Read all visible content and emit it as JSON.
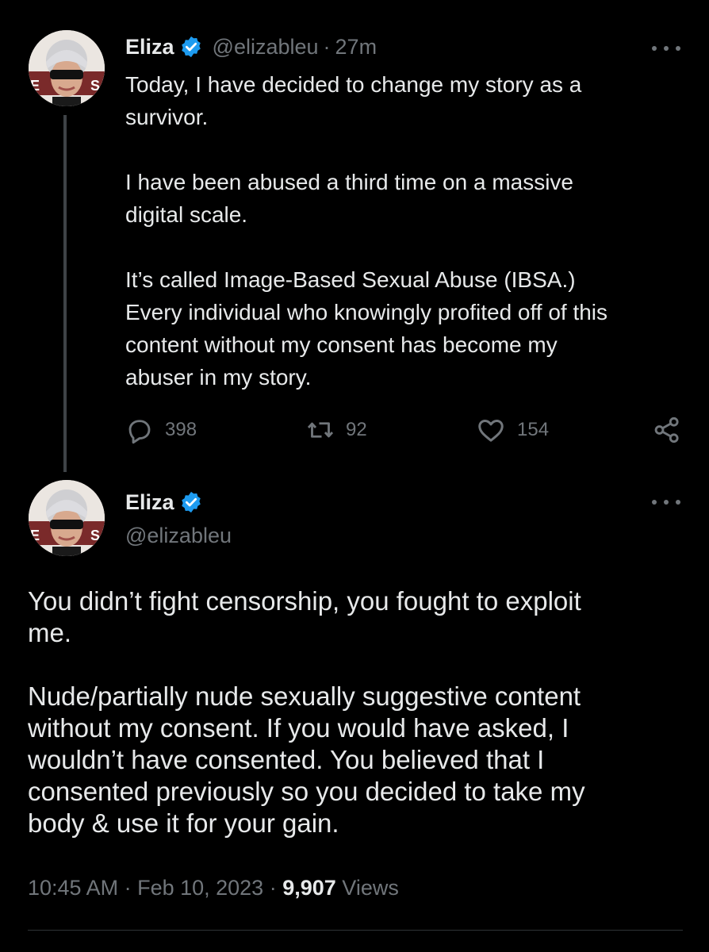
{
  "colors": {
    "background": "#000000",
    "text": "#e7e9ea",
    "secondary_text": "#71767b",
    "verified_blue": "#1d9bf0",
    "divider": "#2f3336"
  },
  "tweet1": {
    "author_name": "Eliza",
    "author_handle": "@elizableu",
    "separator": "·",
    "time": "27m",
    "avatar_icon": "profile-photo",
    "text": "Today, I have decided to change my story as a\nsurvivor.\n\nI have been abused a third time on a massive\ndigital scale.\n\nIt’s called Image-Based Sexual Abuse (IBSA.)\nEvery individual who knowingly profited off of this\ncontent without my consent has become my\nabuser in my story.",
    "replies": "398",
    "retweets": "92",
    "likes": "154"
  },
  "tweet2": {
    "author_name": "Eliza",
    "author_handle": "@elizableu",
    "avatar_icon": "profile-photo",
    "text": "You didn’t fight censorship, you fought to exploit\nme.\n\nNude/partially nude sexually suggestive content\nwithout my consent. If you would have asked, I\nwouldn’t have consented. You believed that I\nconsented previously so you decided to take my\nbody & use it for your gain.",
    "timestamp": "10:45 AM · Feb 10, 2023 · ",
    "views_count": "9,907",
    "views_label": "Views"
  }
}
